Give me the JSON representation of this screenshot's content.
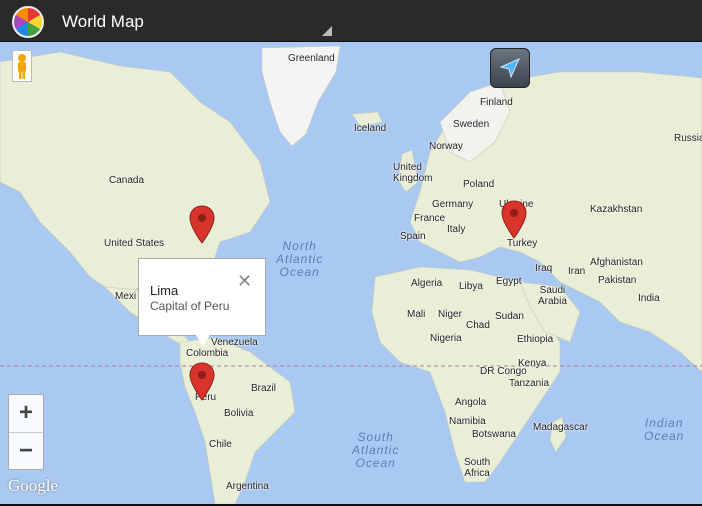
{
  "app": {
    "title": "World Map",
    "icon": "app-globe-icon"
  },
  "map": {
    "attribution": "Google",
    "zoom_in": "+",
    "zoom_out": "−",
    "labels": {
      "greenland": "Greenland",
      "iceland": "Iceland",
      "finland": "Finland",
      "sweden": "Sweden",
      "norway": "Norway",
      "russia": "Russia",
      "uk": "United\nKingdom",
      "poland": "Poland",
      "germany": "Germany",
      "ukraine": "Ukraine",
      "kazakhstan": "Kazakhstan",
      "france": "France",
      "spain": "Spain",
      "italy": "Italy",
      "turkey": "Turkey",
      "canada": "Canada",
      "united_states": "United States",
      "mexico": "Mexi",
      "afghanistan": "Afghanistan",
      "iraq": "Iraq",
      "iran": "Iran",
      "pakistan": "Pakistan",
      "india": "India",
      "algeria": "Algeria",
      "libya": "Libya",
      "egypt": "Egypt",
      "saudi_arabia": "Saudi\nArabia",
      "mali": "Mali",
      "niger": "Niger",
      "chad": "Chad",
      "sudan": "Sudan",
      "nigeria": "Nigeria",
      "ethiopia": "Ethiopia",
      "venezuela": "Venezuela",
      "colombia": "Colombia",
      "brazil": "Brazil",
      "peru": "Peru",
      "bolivia": "Bolivia",
      "chile": "Chile",
      "argentina": "Argentina",
      "dr_congo": "DR Congo",
      "kenya": "Kenya",
      "tanzania": "Tanzania",
      "angola": "Angola",
      "namibia": "Namibia",
      "botswana": "Botswana",
      "madagascar": "Madagascar",
      "south_africa": "South\nAfrica"
    },
    "oceans": {
      "north_atlantic": "North\nAtlantic\nOcean",
      "south_atlantic": "South\nAtlantic\nOcean",
      "indian": "Indian\nOcean"
    },
    "markers": [
      "washington-marker",
      "lima-marker",
      "ankara-marker"
    ],
    "info_window": {
      "title": "Lima",
      "subtitle": "Capital of Peru",
      "close": "✕"
    }
  },
  "colors": {
    "ocean": "#a9c9f2",
    "land": "#e8efd6",
    "marker": "#d9342b",
    "actionbar": "#2a2a2a"
  }
}
